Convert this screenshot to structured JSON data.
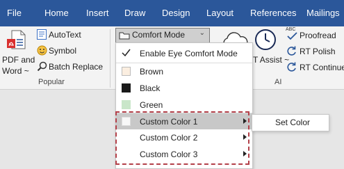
{
  "tabs": [
    "File",
    "Home",
    "Insert",
    "Draw",
    "Design",
    "Layout",
    "References",
    "Mailings"
  ],
  "ribbon": {
    "pdf_and_word": [
      "PDF and",
      "Word ~"
    ],
    "autotext": "AutoText",
    "symbol": "Symbol",
    "batch_replace": "Batch Replace",
    "popular_group": "Popular",
    "comfort_mode": "Comfort Mode",
    "rt_assist": "T Assist ~",
    "proofread": "Proofread",
    "rt_polish": "RT Polish",
    "rt_continue": "RT Continue",
    "ai_group": "AI",
    "abc_badge": "ABC"
  },
  "menu": {
    "enable_eye_comfort": "Enable Eye Comfort Mode",
    "brown": "Brown",
    "black": "Black",
    "green": "Green",
    "custom1": "Custom Color 1",
    "custom2": "Custom Color 2",
    "custom3": "Custom Color 3"
  },
  "submenu": {
    "set_color": "Set Color"
  },
  "colors": {
    "tabbar": "#2b579a",
    "brown_swatch": "#fbeee0",
    "black_swatch": "#1a1a1a",
    "green_swatch": "#c9e6c9",
    "custom1_swatch": "#f8f8f8",
    "highlight": "#c8c8c8",
    "dashed_outline": "#b34049"
  }
}
